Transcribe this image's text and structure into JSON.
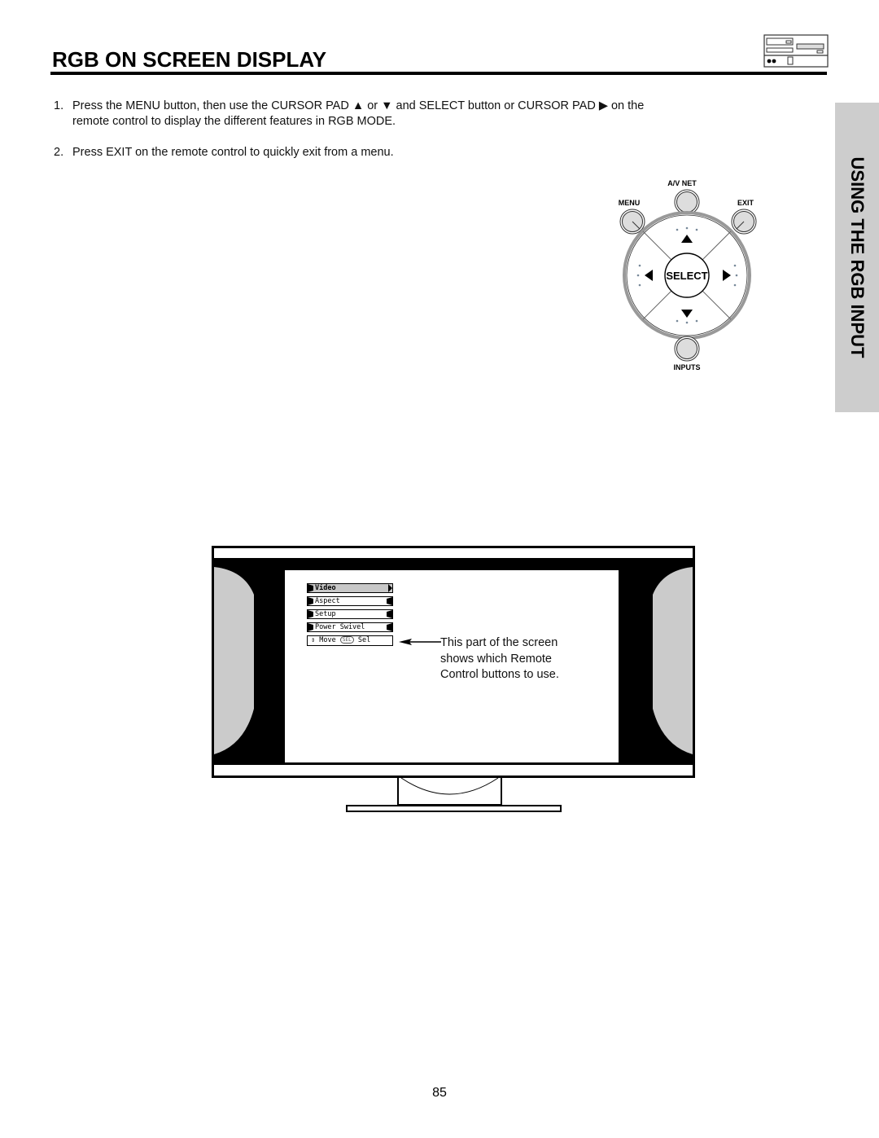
{
  "page": {
    "title": "RGB ON SCREEN DISPLAY",
    "side_tab": "USING THE RGB INPUT",
    "page_number": "85"
  },
  "steps": [
    {
      "number": "1.",
      "lines": [
        "Press the MENU button, then use the CURSOR PAD ▲ or ▼ and SELECT button or CURSOR PAD ▶ on the",
        "remote control to display the different features in RGB MODE."
      ]
    },
    {
      "number": "2.",
      "lines": [
        "Press EXIT on the remote control to quickly exit from a menu."
      ]
    }
  ],
  "remote": {
    "av_net": "A/V NET",
    "menu": "MENU",
    "exit": "EXIT",
    "select": "SELECT",
    "inputs": "INPUTS"
  },
  "osd_menu": {
    "items": [
      {
        "label": "Video",
        "selected": true
      },
      {
        "label": "Aspect",
        "selected": false
      },
      {
        "label": "Setup",
        "selected": false
      },
      {
        "label": "Power Swivel",
        "selected": false
      }
    ],
    "help": {
      "move_icon": "⇕",
      "move": "Move",
      "sel_badge": "SEL",
      "sel": "Sel"
    }
  },
  "callout": {
    "lines": [
      "This part of the screen",
      "shows which Remote",
      "Control buttons to use."
    ]
  }
}
